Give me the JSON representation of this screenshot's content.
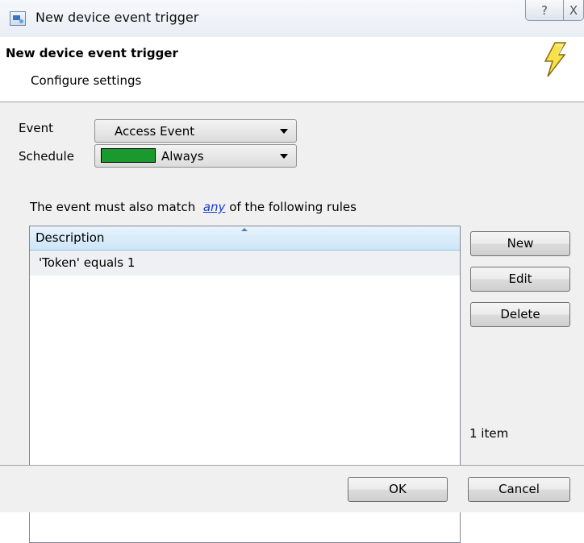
{
  "window": {
    "title": "New device event trigger",
    "help_glyph": "?",
    "close_glyph": "X"
  },
  "header": {
    "title": "New device event trigger",
    "subtitle": "Configure settings"
  },
  "form": {
    "event_label": "Event",
    "event_value": "Access Event",
    "schedule_label": "Schedule",
    "schedule_value": "Always",
    "schedule_color": "#1a9a2e"
  },
  "rules": {
    "prefix": "The event must also match",
    "link": "any",
    "suffix": "of the following rules",
    "column_header": "Description",
    "items": [
      "'Token' equals 1"
    ],
    "count_text": "1 item"
  },
  "buttons": {
    "new": "New",
    "edit": "Edit",
    "delete": "Delete",
    "ok": "OK",
    "cancel": "Cancel"
  },
  "icons": {
    "window": "device-trigger-icon",
    "header": "lightning-bolt-icon"
  }
}
